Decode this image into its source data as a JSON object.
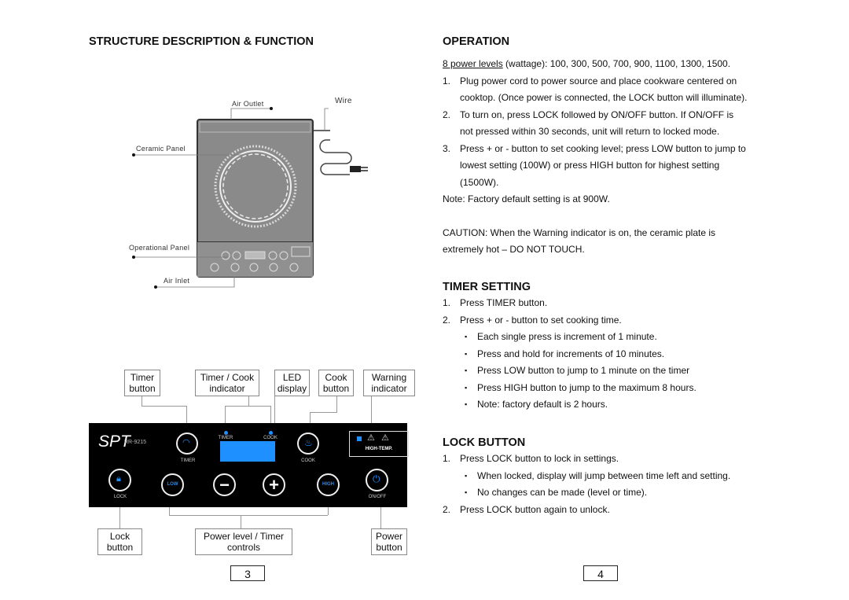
{
  "left_page": {
    "heading": "STRUCTURE DESCRIPTION & FUNCTION",
    "diagram": {
      "labels": {
        "air_outlet": "Air Outlet",
        "wire": "Wire",
        "ceramic_panel": "Ceramic Panel",
        "operational_panel": "Operational Panel",
        "air_inlet": "Air Inlet"
      }
    },
    "callouts_top": [
      {
        "line1": "Timer",
        "line2": "button"
      },
      {
        "line1": "Timer / Cook",
        "line2": "indicator"
      },
      {
        "line1": "LED",
        "line2": "display"
      },
      {
        "line1": "Cook",
        "line2": "button"
      },
      {
        "line1": "Warning",
        "line2": "indicator"
      }
    ],
    "callouts_bottom": [
      {
        "line1": "Lock",
        "line2": "button"
      },
      {
        "line1": "Power level / Timer",
        "line2": "controls"
      },
      {
        "line1": "Power",
        "line2": "button"
      }
    ],
    "control_panel": {
      "brand": "SPT",
      "model": "RR-9215",
      "timer_label": "TIMER",
      "cook_label": "COOK",
      "timer_indicator": "TIMER",
      "cook_indicator": "COOK",
      "warning_text": "HIGH-TEMP.",
      "lock_label": "LOCK",
      "low_label": "LOW",
      "high_label": "HIGH",
      "onoff_label": "ON/OFF",
      "minus": "−",
      "plus": "+",
      "accent_color": "#1e90ff"
    },
    "page_number": "3"
  },
  "right_page": {
    "operation": {
      "heading": "OPERATION",
      "power_levels_link": "8 power levels",
      "power_levels_rest": " (wattage): 100, 300, 500, 700, 900, 1100, 1300, 1500.",
      "steps": [
        {
          "num": "1.",
          "lines": [
            "Plug power cord to power source and place cookware centered on",
            "cooktop. (Once power is connected, the LOCK button will illuminate)."
          ]
        },
        {
          "num": "2.",
          "lines": [
            "To turn on, press LOCK followed by ON/OFF button. If ON/OFF is",
            "not pressed within 30 seconds, unit will return to locked mode."
          ]
        },
        {
          "num": "3.",
          "lines": [
            "Press + or - button to set cooking level; press LOW button to jump to",
            "lowest setting (100W) or press HIGH button for highest setting",
            "(1500W)."
          ]
        }
      ],
      "note": "Note: Factory default setting is at 900W.",
      "caution_lines": [
        "CAUTION: When the Warning indicator is on, the ceramic plate is",
        "extremely hot – DO NOT TOUCH."
      ]
    },
    "timer_setting": {
      "heading": "TIMER SETTING",
      "step1": "Press TIMER button.",
      "step2": "Press + or - button to set cooking time.",
      "bullets": [
        "Each single press is increment of 1 minute.",
        "Press and hold for increments of 10 minutes.",
        "Press LOW button to jump to 1 minute on the timer",
        "Press HIGH button to jump to the maximum 8 hours.",
        "Note: factory default is 2 hours."
      ]
    },
    "lock_button": {
      "heading": "LOCK BUTTON",
      "step1": "Press LOCK button to lock in settings.",
      "bullets": [
        "When locked, display will jump between time left and setting.",
        "No changes can be made (level or time)."
      ],
      "step2": "Press LOCK button again to unlock."
    },
    "page_number": "4"
  },
  "markers": {
    "num1": "1.",
    "num2": "2.",
    "num3": "3.",
    "bullet": "▪"
  }
}
